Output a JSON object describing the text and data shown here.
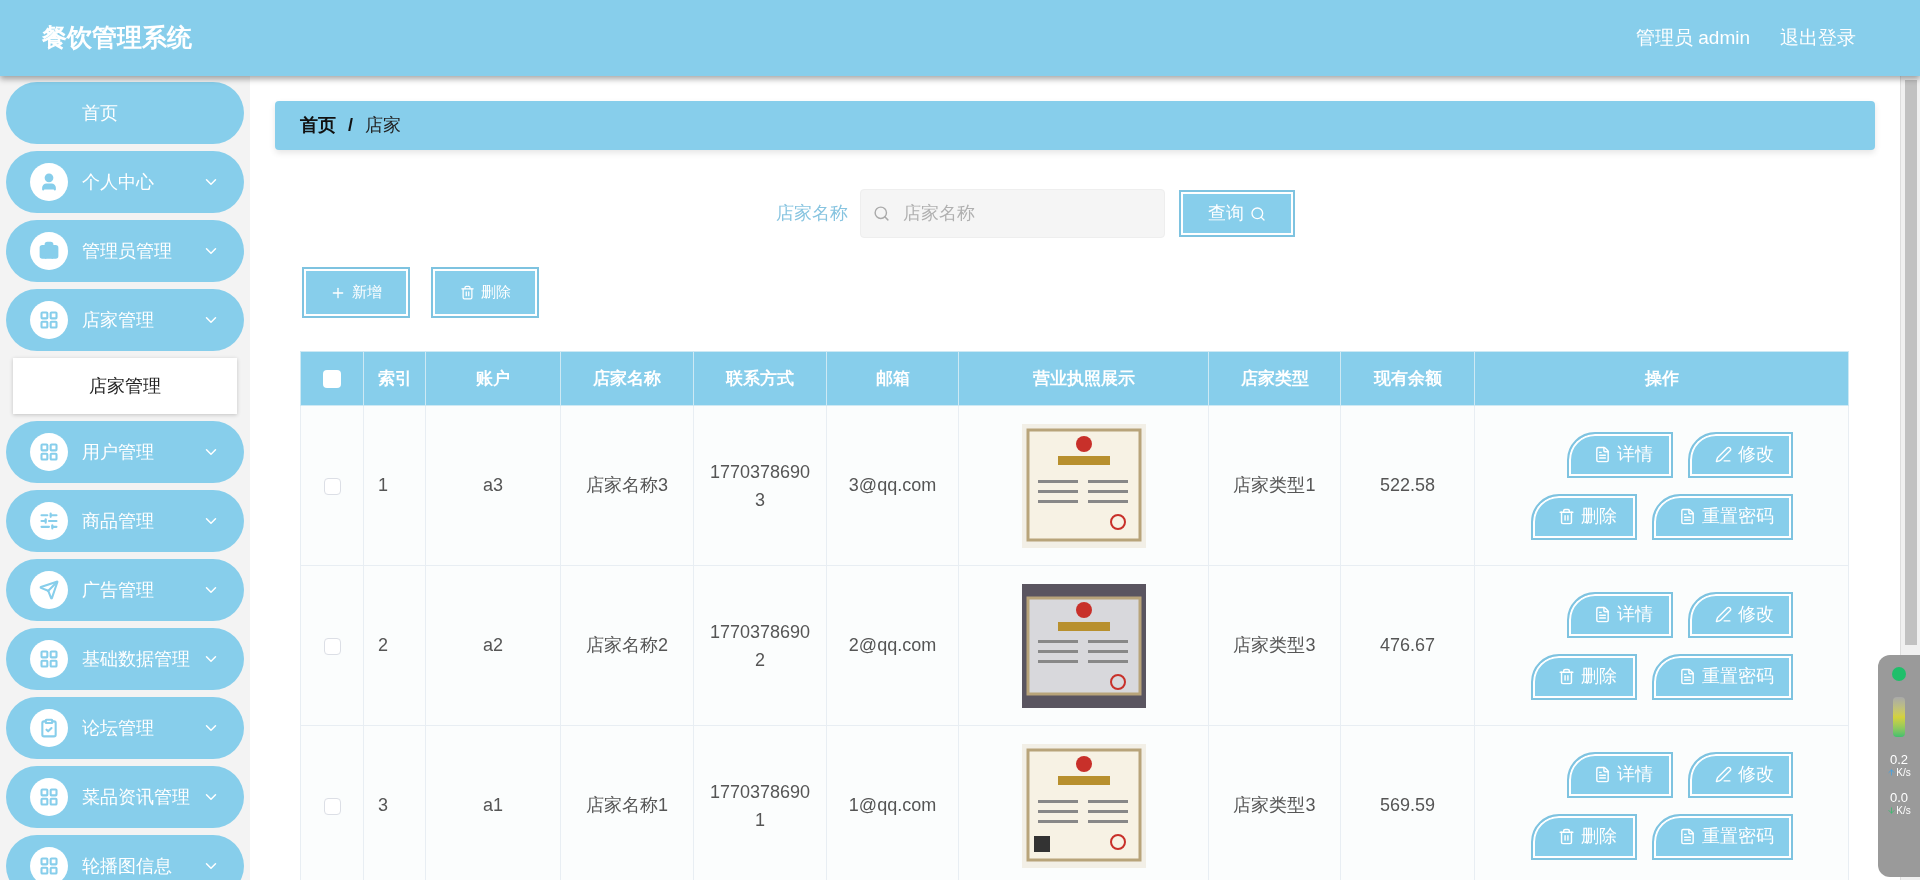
{
  "header": {
    "title": "餐饮管理系统",
    "user": "管理员 admin",
    "logout": "退出登录"
  },
  "sidebar": {
    "items": [
      {
        "label": "首页"
      },
      {
        "label": "个人中心"
      },
      {
        "label": "管理员管理"
      },
      {
        "label": "店家管理",
        "children": [
          {
            "label": "店家管理"
          }
        ]
      },
      {
        "label": "用户管理"
      },
      {
        "label": "商品管理"
      },
      {
        "label": "广告管理"
      },
      {
        "label": "基础数据管理"
      },
      {
        "label": "论坛管理"
      },
      {
        "label": "菜品资讯管理"
      },
      {
        "label": "轮播图信息"
      }
    ]
  },
  "breadcrumb": [
    "首页",
    "/",
    "店家"
  ],
  "search": {
    "label": "店家名称",
    "placeholder": "店家名称",
    "button": "查询"
  },
  "toolbar": {
    "add": "新增",
    "delete": "删除"
  },
  "table": {
    "header_checked": false,
    "columns": [
      "索引",
      "账户",
      "店家名称",
      "联系方式",
      "邮箱",
      "营业执照展示",
      "店家类型",
      "现有余额",
      "操作"
    ],
    "rows": [
      {
        "checked": false,
        "index": "1",
        "account": "a3",
        "name": "店家名称3",
        "phone": "17703786903",
        "email": "3@qq.com",
        "type": "店家类型1",
        "balance": "522.58",
        "actions": [
          "详情",
          "修改",
          "删除",
          "重置密码"
        ]
      },
      {
        "checked": false,
        "index": "2",
        "account": "a2",
        "name": "店家名称2",
        "phone": "17703786902",
        "email": "2@qq.com",
        "type": "店家类型3",
        "balance": "476.67",
        "actions": [
          "详情",
          "修改",
          "删除",
          "重置密码"
        ]
      },
      {
        "checked": false,
        "index": "3",
        "account": "a1",
        "name": "店家名称1",
        "phone": "17703786901",
        "email": "1@qq.com",
        "type": "店家类型3",
        "balance": "569.59",
        "actions": [
          "详情",
          "修改",
          "删除",
          "重置密码"
        ]
      }
    ]
  },
  "net_widget": {
    "upload": "0.2",
    "upload_unit": "K/s",
    "download": "0.0",
    "download_unit": "K/s"
  }
}
